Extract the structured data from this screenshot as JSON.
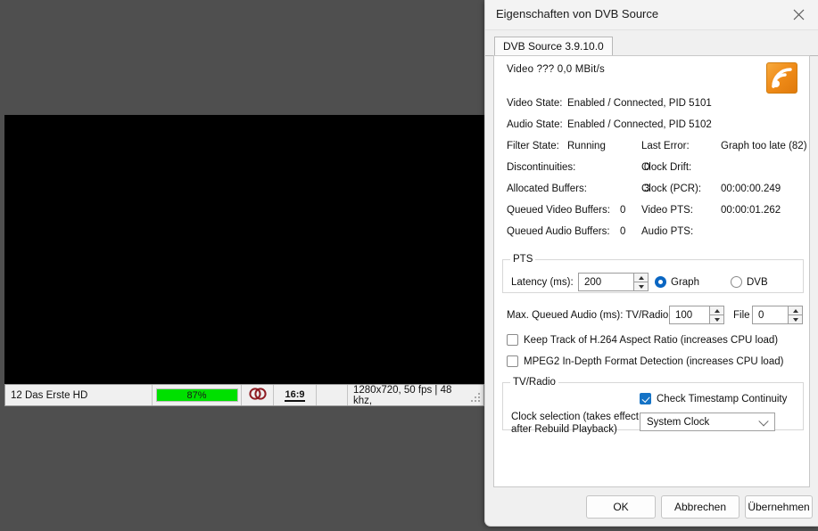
{
  "player": {
    "status_bar": {
      "channel": "12 Das Erste HD",
      "signal_percent_label": "87%",
      "signal_percent_value": 87,
      "audio_mode_icon": "stereo-icon",
      "aspect_ratio": "16:9",
      "stream_info": "1280x720, 50 fps | 48 khz,",
      "resize_grip_icon": "resize-grip-icon"
    }
  },
  "dialog": {
    "title": "Eigenschaften von DVB Source",
    "close_icon": "close-icon",
    "tab": {
      "label": "DVB Source 3.9.10.0"
    },
    "logo_icon": "dvb-signal-wave-icon",
    "bitrate_line": "Video  ???   0,0 MBit/s",
    "stats": {
      "video_state_label": "Video State:",
      "video_state_value": "Enabled / Connected, PID 5101",
      "audio_state_label": "Audio State:",
      "audio_state_value": "Enabled / Connected, PID 5102",
      "filter_state_label": "Filter State:",
      "filter_state_value": "Running",
      "last_error_label": "Last Error:",
      "last_error_value": "Graph too late (82)",
      "discontinuities_label": "Discontinuities:",
      "discontinuities_value": "0",
      "clock_drift_label": "Clock Drift:",
      "clock_drift_value": "",
      "allocated_buffers_label": "Allocated Buffers:",
      "allocated_buffers_value": "3",
      "clock_pcr_label": "Clock (PCR):",
      "clock_pcr_value": "00:00:00.249",
      "queued_video_label": "Queued Video Buffers:",
      "queued_video_value": "0",
      "video_pts_label": "Video PTS:",
      "video_pts_value": "00:00:01.262",
      "queued_audio_label": "Queued Audio Buffers:",
      "queued_audio_value": "0",
      "audio_pts_label": "Audio PTS:",
      "audio_pts_value": ""
    },
    "pts_group": {
      "legend": "PTS",
      "latency_label": "Latency (ms):",
      "latency_value": "200",
      "graph_option": "Graph",
      "dvb_option": "DVB",
      "selected_option": "Graph"
    },
    "max_queued_audio": {
      "label": "Max. Queued Audio (ms): TV/Radio",
      "tvradio_value": "100",
      "file_label": "File",
      "file_value": "0"
    },
    "checkboxes": [
      {
        "label": "Keep Track of H.264 Aspect Ratio (increases CPU load)",
        "checked": false
      },
      {
        "label": "MPEG2 In-Depth Format Detection (increases CPU load)",
        "checked": false
      }
    ],
    "tvradio_group": {
      "legend": "TV/Radio",
      "timestamp_label": "Check Timestamp Continuity",
      "timestamp_checked": true,
      "clock_selection_label_line1": "Clock selection (takes effect",
      "clock_selection_label_line2": "after Rebuild Playback)",
      "clock_selection_value": "System Clock",
      "chevron_icon": "chevron-down-icon"
    },
    "buttons": {
      "ok": "OK",
      "cancel": "Abbrechen",
      "apply": "Übernehmen"
    }
  },
  "colors": {
    "signal_green": "#00e000",
    "accent_blue": "#0a66c2",
    "checkbox_blue": "#1573c6",
    "logo_orange": "#ef8b18",
    "desktop": "#4f4f4f"
  }
}
